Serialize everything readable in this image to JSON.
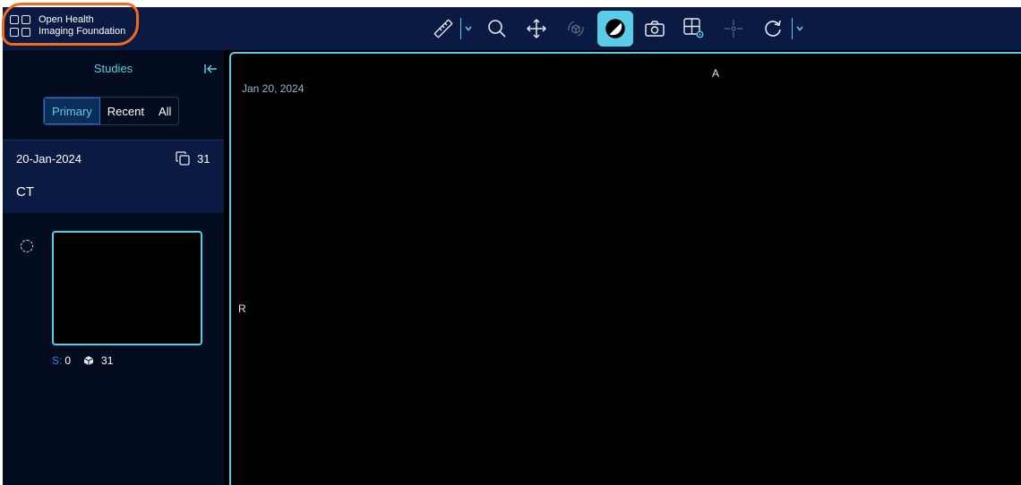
{
  "header": {
    "logo_line1": "Open Health",
    "logo_line2": "Imaging Foundation",
    "tools": [
      {
        "name": "measurement",
        "icon": "ruler-icon"
      },
      {
        "name": "zoom",
        "icon": "magnifier-icon"
      },
      {
        "name": "pan",
        "icon": "move-arrows-icon"
      },
      {
        "name": "rotate-3d",
        "icon": "rotate-cube-icon"
      },
      {
        "name": "window-level",
        "icon": "contrast-icon",
        "active": true
      },
      {
        "name": "capture",
        "icon": "camera-icon"
      },
      {
        "name": "layout",
        "icon": "grid-settings-icon"
      },
      {
        "name": "crosshairs",
        "icon": "crosshair-icon"
      },
      {
        "name": "reset",
        "icon": "redo-icon"
      }
    ],
    "accent_color": "#5acce6",
    "bg_color": "#0b1a42"
  },
  "sidebar": {
    "title": "Studies",
    "tabs": [
      "Primary",
      "Recent",
      "All"
    ],
    "active_tab": "Primary",
    "study": {
      "date": "20-Jan-2024",
      "instance_count": "31",
      "modality": "CT"
    },
    "series": {
      "s_label": "S:",
      "s_value": "0",
      "image_count": "31"
    }
  },
  "viewport": {
    "date": "Jan 20, 2024",
    "orientation_top": "A",
    "orientation_left": "R"
  }
}
